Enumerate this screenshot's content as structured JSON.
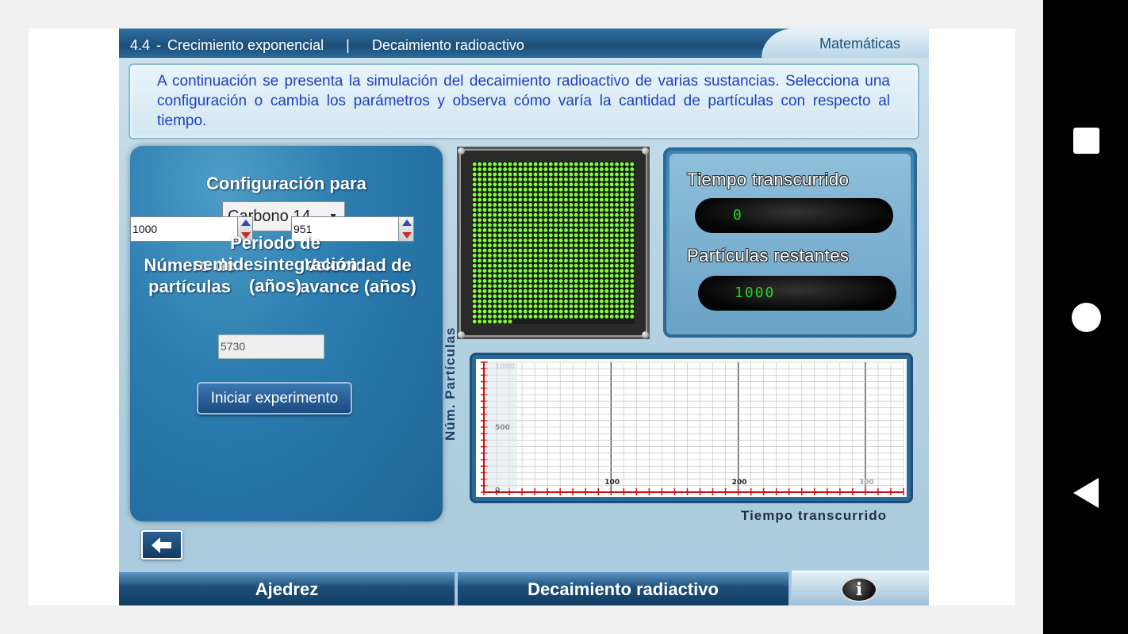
{
  "header": {
    "section": "4.4",
    "separator1": "-",
    "topic": "Crecimiento exponencial",
    "separator2": "|",
    "subtopic": "Decaimiento radioactivo",
    "subject": "Matemáticas"
  },
  "instructions": "A continuación se presenta la simulación del decaimiento radioactivo de varias sustancias. Selecciona una configuración o cambia los parámetros y observa cómo varía la cantidad de partículas con respecto al tiempo.",
  "config": {
    "label": "Configuración para",
    "selected": "Carbono 14",
    "particles_label": "Número de partículas",
    "particles_value": "1000",
    "speed_label": "Velocidad de avance (años)",
    "speed_value": "951",
    "halflife_label": "Periodo de semidesintegración (años)",
    "halflife_value": "5730",
    "start_button": "Iniciar experimento"
  },
  "particle_display": {
    "total": 1000,
    "decayed": 0,
    "color_active": "#7dff3a",
    "color_decayed": "#3a3a3a"
  },
  "readouts": {
    "elapsed_label": "Tiempo transcurrido",
    "elapsed_value": "0",
    "remaining_label": "Partículas restantes",
    "remaining_value": "1000"
  },
  "chart": {
    "ylabel": "Núm. Partículas",
    "xlabel": "Tiempo transcurrido",
    "y_ticks": [
      "0",
      "500",
      "1000"
    ],
    "x_ticks": [
      "100",
      "200",
      "300"
    ]
  },
  "footer": {
    "tab1": "Ajedrez",
    "tab2": "Decaimiento radiactivo",
    "info": "i"
  },
  "colors": {
    "accent": "#1d4f7a",
    "instructions_text": "#1f3fbf",
    "lcd_text": "#2bd22b",
    "axis_ticks": "#d01010"
  }
}
